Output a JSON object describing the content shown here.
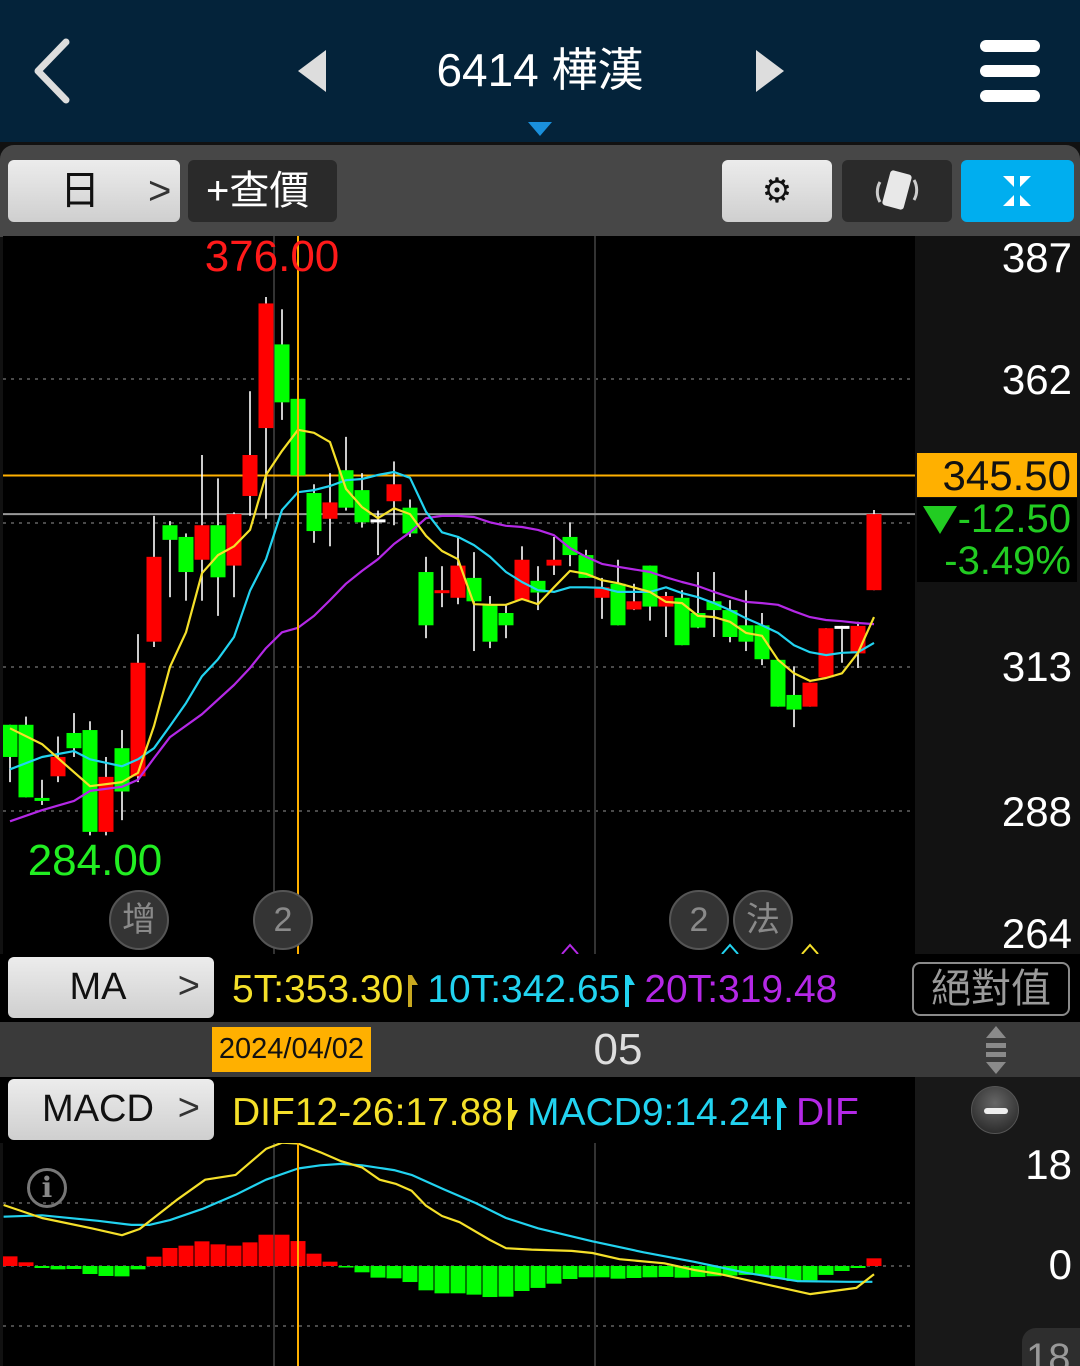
{
  "header": {
    "title": "6414 樺漢"
  },
  "toolbar": {
    "period_label": "日",
    "period_chevron": ">",
    "quote_label": "+查價",
    "settings_icon": "⚙"
  },
  "price_panel": {
    "high_label": "376.00",
    "low_label": "284.00",
    "axis_labels": [
      "387",
      "362",
      "313",
      "288",
      "264"
    ],
    "crosshair_price": "345.50",
    "change": "-12.50",
    "change_pct": "-3.49%",
    "event_badges": [
      "增",
      "2",
      "2",
      "法"
    ]
  },
  "ma_bar": {
    "button_label": "MA",
    "chevron": ">",
    "ma5": "5T:353.30",
    "ma10": "10T:342.65",
    "ma20": "20T:319.48",
    "abs_button": "絕對值"
  },
  "date_bar": {
    "crosshair_date": "2024/04/02",
    "month_label": "05"
  },
  "macd_bar": {
    "button_label": "MACD",
    "chevron": ">",
    "dif": "DIF12-26:17.88",
    "macd": "MACD9:14.24",
    "osc": "DIF"
  },
  "macd_panel": {
    "axis_labels": [
      "18",
      "0"
    ],
    "partial_label": "18"
  },
  "colors": {
    "header_bg": "#04233a",
    "up": "#ff0000",
    "down": "#00ff00",
    "ma5": "#f5e02a",
    "ma10": "#22d3f0",
    "ma20": "#b428e6",
    "crosshair": "#ffb000",
    "accent_blue": "#00aeef"
  },
  "chart_data": {
    "type": "candlestick",
    "symbol": "6414 樺漢",
    "period": "日",
    "price_ylim": [
      264,
      387
    ],
    "crosshair": {
      "date": "2024/04/02",
      "index": 18,
      "price": 345.5
    },
    "ohlc": [
      [
        302.9,
        302.9,
        293.1,
        297.4
      ],
      [
        302.9,
        304.3,
        290.5,
        290.5
      ],
      [
        290.4,
        293.5,
        289.2,
        289.9
      ],
      [
        294.1,
        300.9,
        293.1,
        297.4
      ],
      [
        301.5,
        304.9,
        297.4,
        298.9
      ],
      [
        302.0,
        303.5,
        284.0,
        284.6
      ],
      [
        284.6,
        297.4,
        284.0,
        294.0
      ],
      [
        298.9,
        302.0,
        286.6,
        291.5
      ],
      [
        294.1,
        318.4,
        293.1,
        313.5
      ],
      [
        317.1,
        338.6,
        316.2,
        331.6
      ],
      [
        337.0,
        337.7,
        324.7,
        334.5
      ],
      [
        335.0,
        335.6,
        324.1,
        329.0
      ],
      [
        331.1,
        349.0,
        324.1,
        337.0
      ],
      [
        337.0,
        345.0,
        321.5,
        328.1
      ],
      [
        330.1,
        339.2,
        324.7,
        338.9
      ],
      [
        342.0,
        359.9,
        338.6,
        349.0
      ],
      [
        353.6,
        376.0,
        338.1,
        374.9
      ],
      [
        367.9,
        373.9,
        355.0,
        358.0
      ],
      [
        358.6,
        358.6,
        345.5,
        345.5
      ],
      [
        342.5,
        344.0,
        334.0,
        336.0
      ],
      [
        338.1,
        345.9,
        333.4,
        340.9
      ],
      [
        346.4,
        352.1,
        339.5,
        340.0
      ],
      [
        343.0,
        345.9,
        336.6,
        337.5
      ],
      [
        338.0,
        339.5,
        331.9,
        338.0
      ],
      [
        341.1,
        347.9,
        337.0,
        344.0
      ],
      [
        340.0,
        341.4,
        335.0,
        335.6
      ],
      [
        329.0,
        331.6,
        317.7,
        319.9
      ],
      [
        325.5,
        330.0,
        323.0,
        325.9
      ],
      [
        324.6,
        335.0,
        323.5,
        330.1
      ],
      [
        328.0,
        332.4,
        315.5,
        324.0
      ],
      [
        323.5,
        324.9,
        316.0,
        317.1
      ],
      [
        322.0,
        323.4,
        317.7,
        319.9
      ],
      [
        324.2,
        333.4,
        324.2,
        331.1
      ],
      [
        327.5,
        330.0,
        322.5,
        325.5
      ],
      [
        330.1,
        335.0,
        328.5,
        331.1
      ],
      [
        335.0,
        337.5,
        330.0,
        331.9
      ],
      [
        331.9,
        332.8,
        328.0,
        328.0
      ],
      [
        324.6,
        328.0,
        321.0,
        326.4
      ],
      [
        327.0,
        331.1,
        319.9,
        319.9
      ],
      [
        322.6,
        327.0,
        322.5,
        324.0
      ],
      [
        330.1,
        330.1,
        320.7,
        323.1
      ],
      [
        323.1,
        325.6,
        317.9,
        324.9
      ],
      [
        324.6,
        325.9,
        316.5,
        316.5
      ],
      [
        322.0,
        329.0,
        319.4,
        319.5
      ],
      [
        324.0,
        329.0,
        317.9,
        322.5
      ],
      [
        322.5,
        324.2,
        317.0,
        317.9
      ],
      [
        319.9,
        325.9,
        315.5,
        317.1
      ],
      [
        319.9,
        322.0,
        313.1,
        314.1
      ],
      [
        314.0,
        314.0,
        306.0,
        306.0
      ],
      [
        308.0,
        312.9,
        302.5,
        305.5
      ],
      [
        306.0,
        310.1,
        306.0,
        310.1
      ],
      [
        311.0,
        319.4,
        311.0,
        319.4
      ],
      [
        319.8,
        319.8,
        313.5,
        319.8
      ],
      [
        315.1,
        320.5,
        312.6,
        319.8
      ],
      [
        325.9,
        339.6,
        325.9,
        338.9
      ]
    ],
    "ma5": [
      [
        0,
        302.3
      ],
      [
        2,
        299.6
      ],
      [
        5,
        292.4
      ],
      [
        7,
        293.1
      ],
      [
        8,
        294.7
      ],
      [
        9,
        302.7
      ],
      [
        10,
        312.8
      ],
      [
        11,
        318.7
      ],
      [
        12,
        328.8
      ],
      [
        13,
        331.9
      ],
      [
        14,
        333.4
      ],
      [
        15,
        336.2
      ],
      [
        16,
        345.6
      ],
      [
        17,
        349.7
      ],
      [
        18,
        353.3
      ],
      [
        19,
        352.8
      ],
      [
        20,
        351.2
      ],
      [
        21,
        343.2
      ],
      [
        22,
        340.1
      ],
      [
        23,
        338.2
      ],
      [
        24,
        339.9
      ],
      [
        25,
        338.9
      ],
      [
        26,
        335.2
      ],
      [
        27,
        332.6
      ],
      [
        28,
        331.2
      ],
      [
        29,
        323.5
      ],
      [
        30,
        323.4
      ],
      [
        31,
        323.4
      ],
      [
        32,
        324.4
      ],
      [
        33,
        323.5
      ],
      [
        34,
        326.4
      ],
      [
        35,
        329.2
      ],
      [
        36,
        328.7
      ],
      [
        37,
        327.6
      ],
      [
        38,
        327.1
      ],
      [
        40,
        325.6
      ],
      [
        41,
        323.9
      ],
      [
        42,
        323.7
      ],
      [
        43,
        321.5
      ],
      [
        44,
        321.3
      ],
      [
        45,
        320.5
      ],
      [
        46,
        318.6
      ],
      [
        47,
        318.1
      ],
      [
        48,
        314.0
      ],
      [
        49,
        311.7
      ],
      [
        50,
        310.4
      ],
      [
        51,
        310.9
      ],
      [
        52,
        311.7
      ],
      [
        53,
        315.2
      ],
      [
        54,
        321.3
      ]
    ],
    "ma10": [
      [
        0,
        295.3
      ],
      [
        2,
        297.4
      ],
      [
        4,
        298.4
      ],
      [
        5,
        297.0
      ],
      [
        7,
        295.8
      ],
      [
        8,
        297.0
      ],
      [
        9,
        298.9
      ],
      [
        10,
        302.7
      ],
      [
        11,
        306.6
      ],
      [
        12,
        311.2
      ],
      [
        13,
        314.1
      ],
      [
        14,
        317.9
      ],
      [
        15,
        325.8
      ],
      [
        16,
        331.2
      ],
      [
        17,
        339.6
      ],
      [
        18,
        342.65
      ],
      [
        19,
        343.0
      ],
      [
        20,
        343.7
      ],
      [
        21,
        344.7
      ],
      [
        22,
        344.9
      ],
      [
        23,
        345.6
      ],
      [
        24,
        346.1
      ],
      [
        25,
        345.1
      ],
      [
        26,
        339.3
      ],
      [
        27,
        335.8
      ],
      [
        28,
        335.0
      ],
      [
        29,
        333.6
      ],
      [
        30,
        331.6
      ],
      [
        31,
        329.0
      ],
      [
        32,
        327.3
      ],
      [
        33,
        325.9
      ],
      [
        34,
        325.6
      ],
      [
        35,
        326.4
      ],
      [
        36,
        326.4
      ],
      [
        37,
        326.3
      ],
      [
        38,
        325.6
      ],
      [
        40,
        325.6
      ],
      [
        41,
        326.4
      ],
      [
        42,
        325.4
      ],
      [
        43,
        324.7
      ],
      [
        44,
        323.7
      ],
      [
        45,
        322.5
      ],
      [
        46,
        321.1
      ],
      [
        47,
        319.9
      ],
      [
        48,
        318.6
      ],
      [
        49,
        316.5
      ],
      [
        50,
        315.3
      ],
      [
        51,
        314.8
      ],
      [
        52,
        315.2
      ],
      [
        53,
        315.3
      ],
      [
        54,
        316.9
      ]
    ],
    "ma20": [
      [
        0,
        286.4
      ],
      [
        2,
        288.3
      ],
      [
        4,
        289.9
      ],
      [
        5,
        291.6
      ],
      [
        7,
        292.3
      ],
      [
        8,
        293.5
      ],
      [
        9,
        297.2
      ],
      [
        10,
        300.8
      ],
      [
        12,
        304.7
      ],
      [
        14,
        309.7
      ],
      [
        15,
        312.6
      ],
      [
        16,
        316.0
      ],
      [
        17,
        318.7
      ],
      [
        18,
        319.48
      ],
      [
        19,
        321.5
      ],
      [
        20,
        324.2
      ],
      [
        21,
        327.0
      ],
      [
        22,
        329.2
      ],
      [
        23,
        331.2
      ],
      [
        24,
        333.8
      ],
      [
        25,
        335.8
      ],
      [
        26,
        338.2
      ],
      [
        27,
        338.6
      ],
      [
        28,
        338.6
      ],
      [
        29,
        338.4
      ],
      [
        30,
        337.5
      ],
      [
        31,
        336.9
      ],
      [
        32,
        336.7
      ],
      [
        33,
        336.2
      ],
      [
        34,
        335.3
      ],
      [
        35,
        333.1
      ],
      [
        36,
        331.6
      ],
      [
        37,
        330.4
      ],
      [
        38,
        329.9
      ],
      [
        40,
        329.0
      ],
      [
        41,
        328.1
      ],
      [
        42,
        327.3
      ],
      [
        43,
        326.6
      ],
      [
        44,
        325.6
      ],
      [
        45,
        324.7
      ],
      [
        46,
        323.9
      ],
      [
        47,
        323.7
      ],
      [
        48,
        323.4
      ],
      [
        49,
        322.3
      ],
      [
        50,
        321.3
      ],
      [
        51,
        320.8
      ],
      [
        52,
        320.6
      ],
      [
        53,
        320.3
      ],
      [
        54,
        320.1
      ]
    ],
    "macd_ylim": [
      -15,
      18
    ],
    "macd_hist": [
      1.41,
      0.54,
      -0.29,
      -0.49,
      -0.44,
      -1.17,
      -1.46,
      -1.51,
      -0.49,
      1.36,
      2.63,
      2.97,
      3.6,
      3.16,
      2.97,
      3.45,
      4.57,
      4.57,
      3.64,
      1.8,
      0.63,
      -0.15,
      -0.92,
      -1.7,
      -1.8,
      -2.34,
      -3.55,
      -3.99,
      -3.99,
      -4.18,
      -4.53,
      -4.48,
      -3.65,
      -3.2,
      -2.58,
      -1.9,
      -1.65,
      -1.65,
      -1.85,
      -1.75,
      -1.65,
      -1.6,
      -1.7,
      -1.6,
      -1.5,
      -1.4,
      -1.3,
      -1.36,
      -1.9,
      -2.19,
      -2.09,
      -1.3,
      -0.73,
      -0.29,
      1.12
    ],
    "dif": [
      [
        -0.4,
        8.9
      ],
      [
        2.0,
        7.0
      ],
      [
        5.1,
        5.5
      ],
      [
        7.0,
        4.5
      ],
      [
        8.1,
        5.4
      ],
      [
        10.4,
        9.6
      ],
      [
        12.2,
        12.6
      ],
      [
        14.1,
        13.3
      ],
      [
        16.0,
        17.1
      ],
      [
        17.0,
        18.0
      ],
      [
        18.0,
        17.88
      ],
      [
        19.4,
        16.6
      ],
      [
        20.7,
        15.3
      ],
      [
        22.0,
        14.4
      ],
      [
        23.1,
        12.6
      ],
      [
        24.1,
        12.0
      ],
      [
        25.1,
        11.0
      ],
      [
        26.0,
        8.8
      ],
      [
        27.0,
        7.3
      ],
      [
        28.1,
        6.4
      ],
      [
        30.0,
        3.8
      ],
      [
        31.0,
        2.6
      ],
      [
        32.6,
        2.4
      ],
      [
        35.1,
        2.2
      ],
      [
        36.4,
        1.9
      ],
      [
        38.1,
        1.0
      ],
      [
        40.9,
        0.4
      ],
      [
        42.8,
        -0.6
      ],
      [
        44.4,
        -1.2
      ],
      [
        47.1,
        -2.6
      ],
      [
        50.0,
        -4.1
      ],
      [
        52.9,
        -3.2
      ],
      [
        54,
        -1.2
      ]
    ],
    "macd_signal": [
      [
        -0.4,
        7.2
      ],
      [
        2.0,
        7.4
      ],
      [
        5.5,
        6.6
      ],
      [
        7.6,
        6.0
      ],
      [
        8.7,
        6.0
      ],
      [
        10.0,
        6.7
      ],
      [
        12.0,
        8.3
      ],
      [
        14.1,
        10.4
      ],
      [
        16.0,
        12.6
      ],
      [
        18.0,
        14.24
      ],
      [
        19.4,
        14.7
      ],
      [
        20.7,
        14.9
      ],
      [
        22.0,
        14.7
      ],
      [
        24.0,
        14.0
      ],
      [
        25.1,
        13.3
      ],
      [
        27.1,
        11.2
      ],
      [
        29.1,
        9.2
      ],
      [
        31.0,
        7.0
      ],
      [
        33.0,
        5.5
      ],
      [
        36.4,
        3.6
      ],
      [
        39.6,
        2.0
      ],
      [
        42.8,
        0.6
      ],
      [
        46.0,
        -1.0
      ],
      [
        49.2,
        -2.2
      ],
      [
        52.4,
        -2.3
      ],
      [
        53.9,
        -2.3
      ]
    ]
  }
}
